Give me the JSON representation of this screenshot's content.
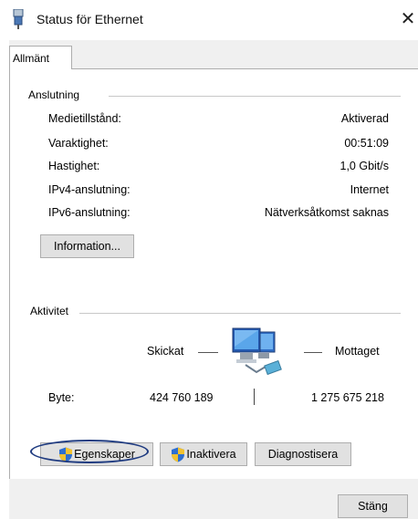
{
  "window": {
    "title": "Status för Ethernet",
    "close_glyph": "✕",
    "icon": "network-connector-icon"
  },
  "tabs": [
    {
      "label": "Allmänt",
      "selected": true
    }
  ],
  "connection": {
    "group_label": "Anslutning",
    "rows": [
      {
        "label": "Medietillstånd:",
        "value": "Aktiverad"
      },
      {
        "label": "Varaktighet:",
        "value": "00:51:09"
      },
      {
        "label": "Hastighet:",
        "value": "1,0 Gbit/s"
      },
      {
        "label": "IPv4-anslutning:",
        "value": "Internet"
      },
      {
        "label": "IPv6-anslutning:",
        "value": "Nätverksåtkomst saknas"
      }
    ],
    "details_button": "Information..."
  },
  "activity": {
    "group_label": "Aktivitet",
    "sent_label": "Skickat",
    "received_label": "Mottaget",
    "bytes_label": "Byte:",
    "bytes_sent": "424 760 189",
    "bytes_received": "1 275 675 218",
    "icon": "network-computers-icon"
  },
  "buttons": {
    "properties": "Egenskaper",
    "disable": "Inaktivera",
    "diagnose": "Diagnostisera",
    "close": "Stäng",
    "shield_icon": "uac-shield-icon"
  },
  "colors": {
    "highlight_ring": "#1f3b80",
    "dialog_bg": "#f0f0f0",
    "button_bg": "#e1e1e1"
  }
}
